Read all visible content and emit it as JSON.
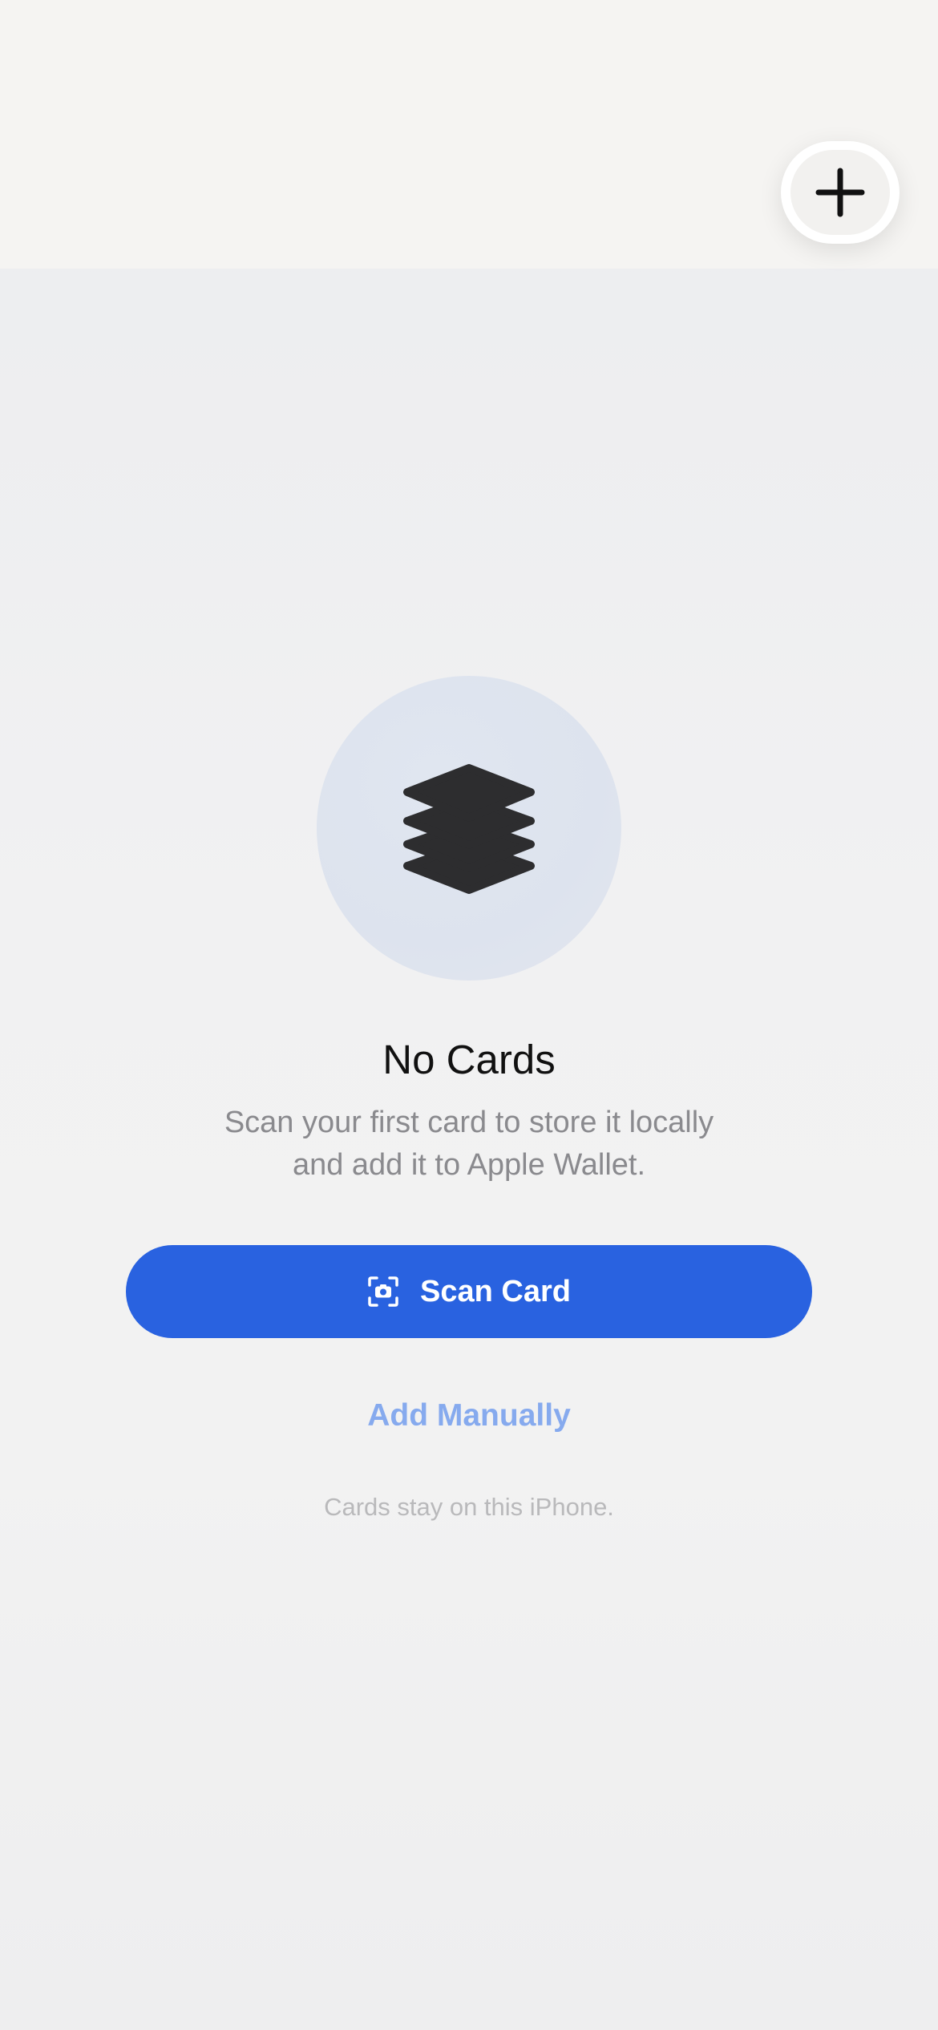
{
  "header": {
    "add_button": {
      "icon": "plus-icon"
    }
  },
  "empty_state": {
    "icon": "stack-icon",
    "title": "No Cards",
    "subtitle_line1": "Scan your first card to store it locally",
    "subtitle_line2": "and add it to Apple Wallet.",
    "primary_button": {
      "label": "Scan Card",
      "icon": "camera-viewfinder-icon"
    },
    "secondary_link": "Add Manually",
    "footnote": "Cards stay on this iPhone."
  },
  "colors": {
    "accent": "#2962e0",
    "link": "#86aaee",
    "subtitle": "#8a8a8e",
    "footnote": "#b9b9bb"
  }
}
